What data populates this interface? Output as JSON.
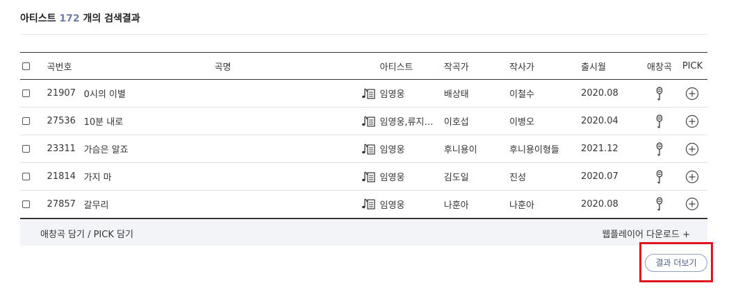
{
  "header": {
    "prefix": "아티스트",
    "count": "172",
    "suffix": "개의 검색결과"
  },
  "columns": {
    "number": "곡번호",
    "title": "곡명",
    "artist": "아티스트",
    "composer": "작곡가",
    "lyricist": "작사가",
    "release": "출시월",
    "favorite": "애창곡",
    "pick": "PICK"
  },
  "rows": [
    {
      "number": "21907",
      "title": "0시의 이별",
      "artist": "임영웅",
      "composer": "배상태",
      "lyricist": "이철수",
      "release": "2020.08"
    },
    {
      "number": "27536",
      "title": "10분 내로",
      "artist": "임영웅,류지…",
      "composer": "이호섭",
      "lyricist": "이병오",
      "release": "2020.04"
    },
    {
      "number": "23311",
      "title": "가슴은 알죠",
      "artist": "임영웅",
      "composer": "후니용이",
      "lyricist": "후니용이형들",
      "release": "2021.12"
    },
    {
      "number": "21814",
      "title": "가지 마",
      "artist": "임영웅",
      "composer": "김도일",
      "lyricist": "진성",
      "release": "2020.07"
    },
    {
      "number": "27857",
      "title": "갈무리",
      "artist": "임영웅",
      "composer": "나훈아",
      "lyricist": "나훈아",
      "release": "2020.08"
    }
  ],
  "icons": {
    "lyrics": "lyrics-note-icon",
    "favorite": "microphone-icon",
    "pick": "plus-circle-icon"
  },
  "footer": {
    "save_label": "애창곡 담기 / PICK 담기",
    "download_label": "웹플레이어 다운로드 +"
  },
  "more_button": {
    "label": "결과 더보기"
  },
  "colors": {
    "accent": "#6e7fa8",
    "highlight": "#e0141e",
    "footer_bg": "#f3f4f8"
  }
}
